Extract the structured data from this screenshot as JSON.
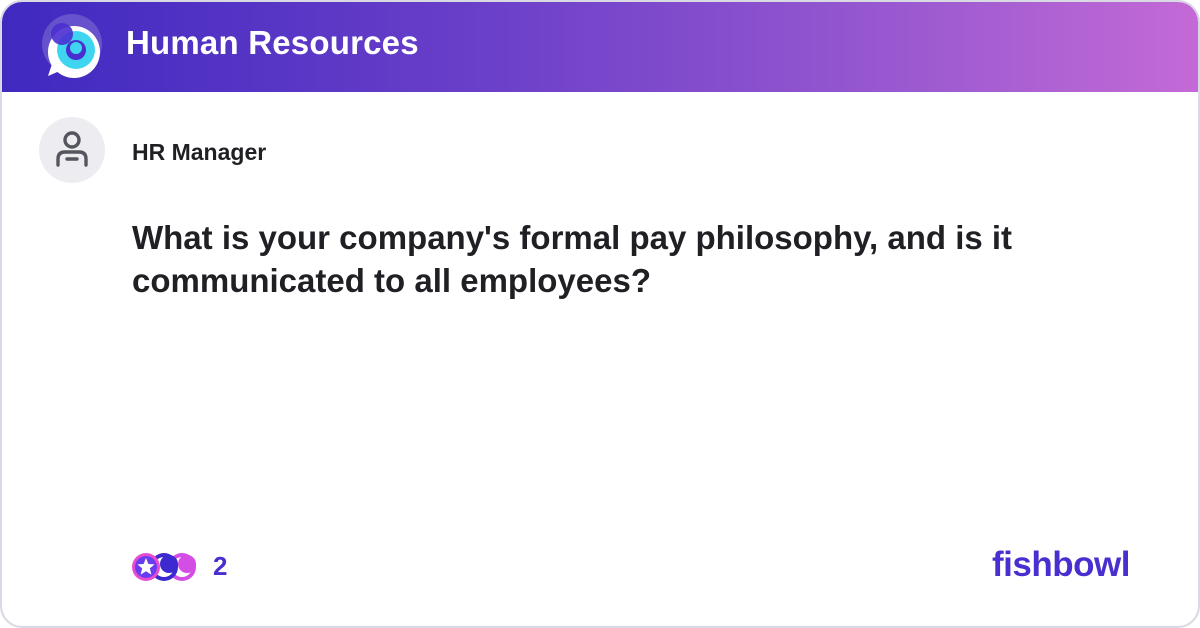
{
  "header": {
    "title": "Human Resources",
    "logo_icon": "fishbowl-bubble-logo",
    "gradient_start": "#3f29c0",
    "gradient_end": "#c46ad6"
  },
  "post": {
    "author_icon": "person-icon",
    "author": "HR Manager",
    "question": "What is your company's formal pay philosophy, and is it communicated to all employees?"
  },
  "footer": {
    "reaction_icons": [
      "star-reaction-icon",
      "moon-reaction-icon",
      "star-reaction-icon"
    ],
    "reaction_count": "2",
    "brand": "fishbowl",
    "accent_color": "#4a2fd0"
  }
}
